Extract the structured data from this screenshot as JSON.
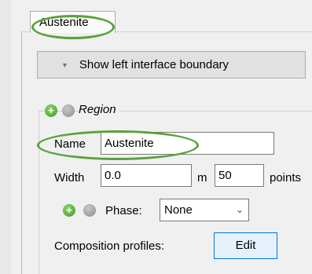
{
  "tab": {
    "label": "Austenite"
  },
  "boundary_button": {
    "label": "Show left interface boundary"
  },
  "region": {
    "title": "Region",
    "name_label": "Name",
    "name_value": "Austenite",
    "width_label": "Width",
    "width_value": "0.0",
    "width_unit": "m",
    "points_value": "50",
    "points_label": "points",
    "phase_label": "Phase:",
    "phase_value": "None",
    "composition_label": "Composition profiles:",
    "edit_label": "Edit"
  },
  "icons": {
    "add": "add-icon",
    "remove": "remove-icon",
    "expand": "triangle-down-icon",
    "dropdown": "chevron-down-icon"
  },
  "colors": {
    "highlight": "#5aa13a",
    "edit_border": "#0078d7",
    "add_icon": "#3d9a2a"
  }
}
